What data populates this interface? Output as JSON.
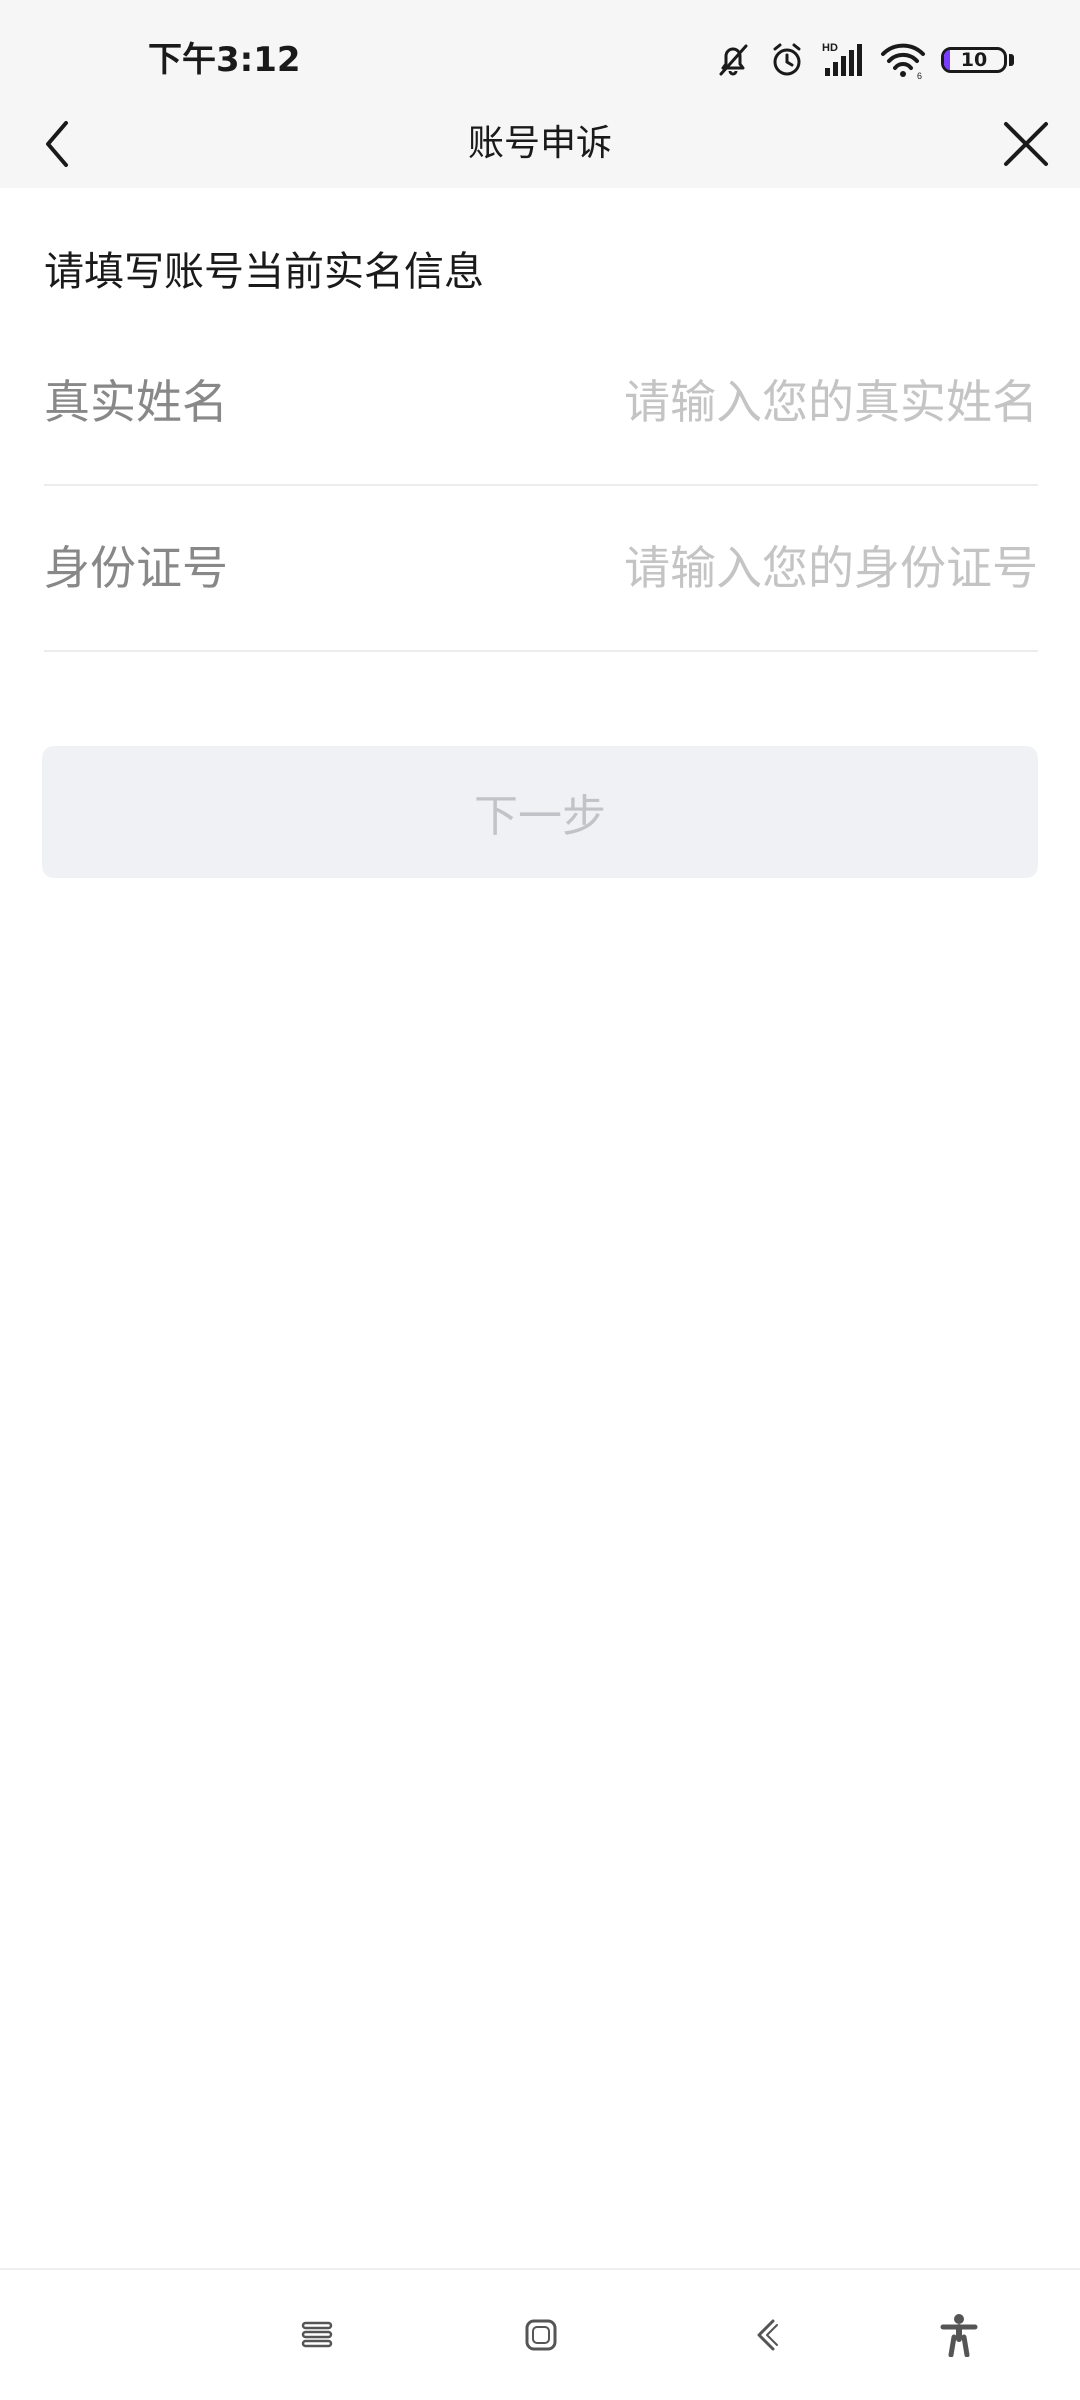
{
  "status_bar": {
    "time": "下午3:12",
    "battery_level": "10",
    "battery_fraction": 0.1,
    "icons": [
      "mute-bell-icon",
      "alarm-icon",
      "hd-signal-icon",
      "wifi-icon",
      "battery-icon"
    ]
  },
  "nav": {
    "title": "账号申诉",
    "back_icon": "back-chevron-icon",
    "close_icon": "close-icon"
  },
  "form": {
    "section_title": "请填写账号当前实名信息",
    "fields": [
      {
        "label": "真实姓名",
        "value": "",
        "placeholder": "请输入您的真实姓名"
      },
      {
        "label": "身份证号",
        "value": "",
        "placeholder": "请输入您的身份证号"
      }
    ],
    "next_button": "下一步"
  },
  "system_nav": {
    "icons": [
      "menu-icon",
      "home-icon",
      "back-icon",
      "accessibility-icon"
    ]
  },
  "colors": {
    "top_bar_bg": "#f6f6f6",
    "text_primary": "#1a1a1a",
    "label_gray": "#888888",
    "placeholder_gray": "#c4c4c4",
    "button_disabled_bg": "#f0f1f4",
    "button_disabled_text": "#c2c3c8",
    "battery_accent": "#7a3cff"
  }
}
